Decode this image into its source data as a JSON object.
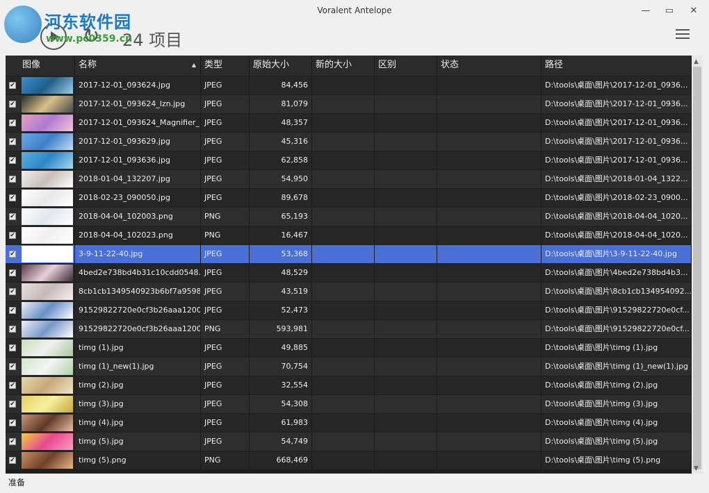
{
  "window": {
    "title": "Voralent Antelope"
  },
  "watermark": {
    "cn": "河东软件园",
    "url": "www.pc0359.cn"
  },
  "toolbar": {
    "count_label": "24 项目"
  },
  "columns": [
    "图像",
    "名称",
    "类型",
    "原始大小",
    "新的大小",
    "区别",
    "状态",
    "路径"
  ],
  "rows": [
    {
      "name": "2017-12-01_093624.jpg",
      "type": "JPEG",
      "size": "84,456",
      "path": "D:\\tools\\桌面\\图片\\2017-12-01_0936...",
      "thumb": [
        "#3a8fd0",
        "#1f5f8a",
        "#9ecbe8"
      ]
    },
    {
      "name": "2017-12-01_093624_lzn.jpg",
      "type": "JPEG",
      "size": "81,079",
      "path": "D:\\tools\\桌面\\图片\\2017-12-01_0936...",
      "thumb": [
        "#2a2a2a",
        "#d8c08a",
        "#4a4a4a"
      ]
    },
    {
      "name": "2017-12-01_093624_Magnifier_...",
      "type": "JPEG",
      "size": "48,357",
      "path": "D:\\tools\\桌面\\图片\\2017-12-01_0936...",
      "thumb": [
        "#e7a0c0",
        "#b07ad0",
        "#f5c5d8"
      ]
    },
    {
      "name": "2017-12-01_093629.jpg",
      "type": "JPEG",
      "size": "45,316",
      "path": "D:\\tools\\桌面\\图片\\2017-12-01_0936...",
      "thumb": [
        "#6aa8e8",
        "#3f7fc8",
        "#c0dff5"
      ]
    },
    {
      "name": "2017-12-01_093636.jpg",
      "type": "JPEG",
      "size": "62,858",
      "path": "D:\\tools\\桌面\\图片\\2017-12-01_0936...",
      "thumb": [
        "#5ab0e0",
        "#2f86c8",
        "#a8d8f0"
      ]
    },
    {
      "name": "2018-01-04_132207.jpg",
      "type": "JPEG",
      "size": "54,950",
      "path": "D:\\tools\\桌面\\图片\\2018-01-04_1322...",
      "thumb": [
        "#f0f0f0",
        "#c8c0b8",
        "#ffffff"
      ]
    },
    {
      "name": "2018-02-23_090050.jpg",
      "type": "JPEG",
      "size": "89,678",
      "path": "D:\\tools\\桌面\\图片\\2018-02-23_0900...",
      "thumb": [
        "#ffffff",
        "#e8e8e8",
        "#ffffff"
      ]
    },
    {
      "name": "2018-04-04_102003.png",
      "type": "PNG",
      "size": "65,193",
      "path": "D:\\tools\\桌面\\图片\\2018-04-04_1020...",
      "thumb": [
        "#ffffff",
        "#e0e6ee",
        "#ffffff"
      ]
    },
    {
      "name": "2018-04-04_102023.png",
      "type": "PNG",
      "size": "16,467",
      "path": "D:\\tools\\桌面\\图片\\2018-04-04_1020...",
      "thumb": [
        "#ffffff",
        "#f0f0f0",
        "#ffffff"
      ]
    },
    {
      "name": "3-9-11-22-40.jpg",
      "type": "JPEG",
      "size": "53,368",
      "path": "D:\\tools\\桌面\\图片\\3-9-11-22-40.jpg",
      "thumb": [
        "#ffffff",
        "#ffffff",
        "#ffffff"
      ],
      "selected": true
    },
    {
      "name": "4bed2e738bd4b31c10cdd0548...",
      "type": "JPEG",
      "size": "48,529",
      "path": "D:\\tools\\桌面\\图片\\4bed2e738bd4b3...",
      "thumb": [
        "#5a3a4a",
        "#e8d0d8",
        "#3a2a3a"
      ]
    },
    {
      "name": "8cb1cb1349540923b6bf7a9598...",
      "type": "JPEG",
      "size": "43,519",
      "path": "D:\\tools\\桌面\\图片\\8cb1cb134954092...",
      "thumb": [
        "#e8e0e0",
        "#c8b8b8",
        "#f8f0f0"
      ]
    },
    {
      "name": "91529822720e0cf3b26aaa1200...",
      "type": "JPEG",
      "size": "52,473",
      "path": "D:\\tools\\桌面\\图片\\91529822720e0cf...",
      "thumb": [
        "#f0f0f8",
        "#6890c8",
        "#ffffff"
      ]
    },
    {
      "name": "91529822720e0cf3b26aaa1200...",
      "type": "PNG",
      "size": "593,981",
      "path": "D:\\tools\\桌面\\图片\\91529822720e0cf...",
      "thumb": [
        "#f0f0f8",
        "#7898c8",
        "#ffffff"
      ]
    },
    {
      "name": "timg (1).jpg",
      "type": "JPEG",
      "size": "49,885",
      "path": "D:\\tools\\桌面\\图片\\timg (1).jpg",
      "thumb": [
        "#c8e0c0",
        "#f0f0f0",
        "#a8c8a0"
      ]
    },
    {
      "name": "timg (1)_new(1).jpg",
      "type": "JPEG",
      "size": "70,754",
      "path": "D:\\tools\\桌面\\图片\\timg (1)_new(1).jpg",
      "thumb": [
        "#d0e8c8",
        "#f4f4f4",
        "#b0d0a8"
      ]
    },
    {
      "name": "timg (2).jpg",
      "type": "JPEG",
      "size": "32,554",
      "path": "D:\\tools\\桌面\\图片\\timg (2).jpg",
      "thumb": [
        "#e8d8a8",
        "#c8a878",
        "#f0e8c8"
      ]
    },
    {
      "name": "timg (3).jpg",
      "type": "JPEG",
      "size": "54,308",
      "path": "D:\\tools\\桌面\\图片\\timg (3).jpg",
      "thumb": [
        "#e8d060",
        "#f8f0a0",
        "#c8a840"
      ]
    },
    {
      "name": "timg (4).jpg",
      "type": "JPEG",
      "size": "61,983",
      "path": "D:\\tools\\桌面\\图片\\timg (4).jpg",
      "thumb": [
        "#c89878",
        "#603828",
        "#e8c0a0"
      ]
    },
    {
      "name": "timg (5).jpg",
      "type": "JPEG",
      "size": "54,749",
      "path": "D:\\tools\\桌面\\图片\\timg (5).jpg",
      "thumb": [
        "#f0d040",
        "#e84890",
        "#f8a0c0"
      ]
    },
    {
      "name": "timg (5).png",
      "type": "PNG",
      "size": "668,469",
      "path": "D:\\tools\\桌面\\图片\\timg (5).png",
      "thumb": [
        "#c89060",
        "#704028",
        "#e8b888"
      ]
    }
  ],
  "status": "准备"
}
